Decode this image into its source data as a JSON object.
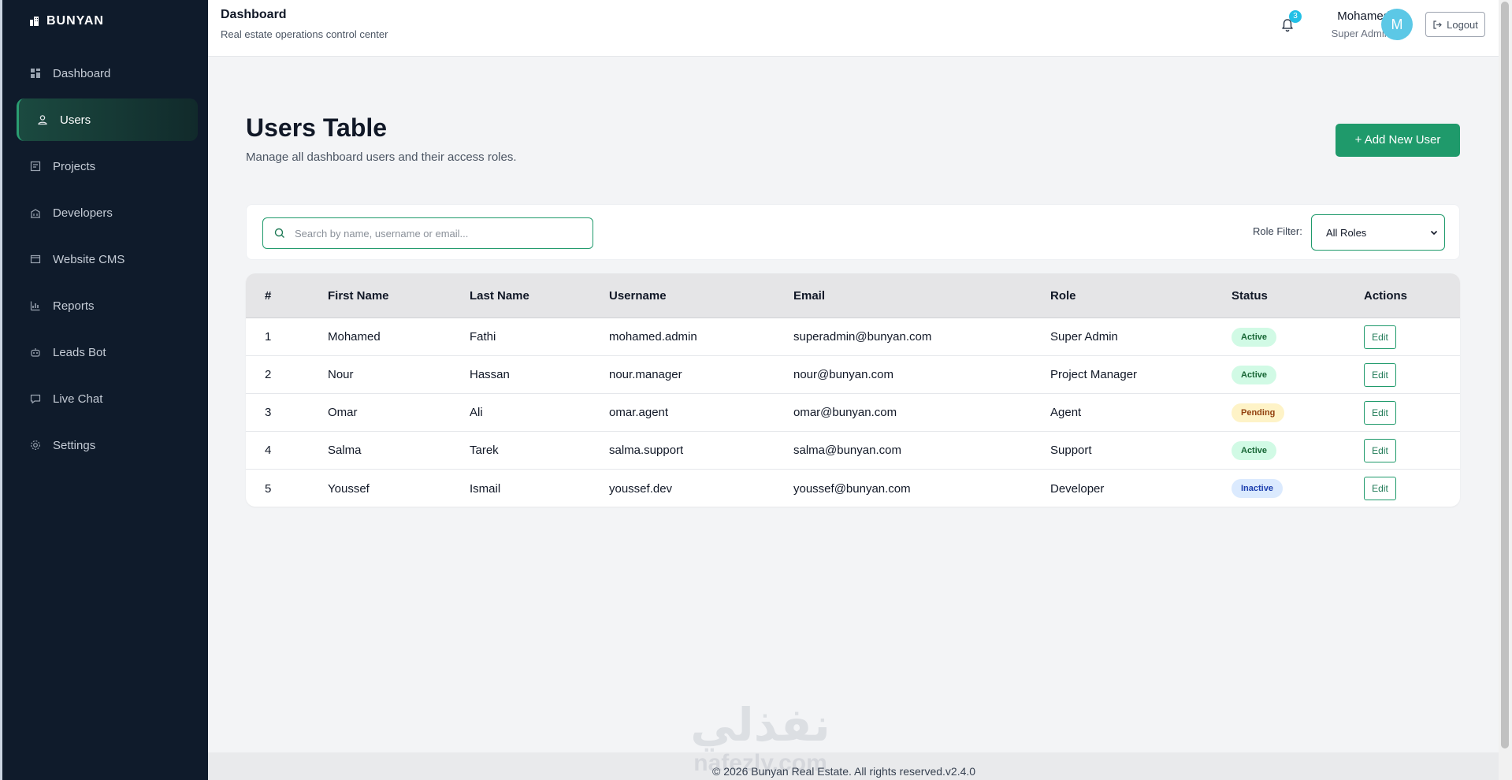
{
  "brand": {
    "name": "BUNYAN"
  },
  "sidebar": {
    "items": [
      {
        "label": "Dashboard",
        "icon": "grid-icon",
        "active": false
      },
      {
        "label": "Users",
        "icon": "users-icon",
        "active": true
      },
      {
        "label": "Projects",
        "icon": "projects-icon",
        "active": false
      },
      {
        "label": "Developers",
        "icon": "building-icon",
        "active": false
      },
      {
        "label": "Website CMS",
        "icon": "cms-icon",
        "active": false
      },
      {
        "label": "Reports",
        "icon": "chart-icon",
        "active": false
      },
      {
        "label": "Leads Bot",
        "icon": "bot-icon",
        "active": false
      },
      {
        "label": "Live Chat",
        "icon": "chat-icon",
        "active": false
      },
      {
        "label": "Settings",
        "icon": "gear-icon",
        "active": false
      }
    ]
  },
  "header": {
    "title": "Dashboard",
    "subtitle": "Real estate operations control center",
    "notification_count": "3",
    "user_name": "Mohamed",
    "user_role": "Super Admin",
    "avatar_initial": "M",
    "logout_label": "Logout"
  },
  "main": {
    "title": "Users Table",
    "subtitle": "Manage all dashboard users and their access roles.",
    "add_button": "+ Add New User",
    "search_placeholder": "Search by name, username or email...",
    "role_filter_label": "Role Filter:",
    "role_filter_value": "All Roles"
  },
  "table": {
    "columns": [
      "#",
      "First Name",
      "Last Name",
      "Username",
      "Email",
      "Role",
      "Status",
      "Actions"
    ],
    "rows": [
      {
        "id": "1",
        "first": "Mohamed",
        "last": "Fathi",
        "username": "mohamed.admin",
        "email": "superadmin@bunyan.com",
        "role": "Super Admin",
        "status": "Active",
        "action": "Edit"
      },
      {
        "id": "2",
        "first": "Nour",
        "last": "Hassan",
        "username": "nour.manager",
        "email": "nour@bunyan.com",
        "role": "Project Manager",
        "status": "Active",
        "action": "Edit"
      },
      {
        "id": "3",
        "first": "Omar",
        "last": "Ali",
        "username": "omar.agent",
        "email": "omar@bunyan.com",
        "role": "Agent",
        "status": "Pending",
        "action": "Edit"
      },
      {
        "id": "4",
        "first": "Salma",
        "last": "Tarek",
        "username": "salma.support",
        "email": "salma@bunyan.com",
        "role": "Support",
        "status": "Active",
        "action": "Edit"
      },
      {
        "id": "5",
        "first": "Youssef",
        "last": "Ismail",
        "username": "youssef.dev",
        "email": "youssef@bunyan.com",
        "role": "Developer",
        "status": "Inactive",
        "action": "Edit"
      }
    ]
  },
  "footer": {
    "text": "© 2026 Bunyan Real Estate. All rights reserved.v2.4.0"
  },
  "watermark": {
    "arabic": "نفذلي",
    "latin": "nafezly.com"
  },
  "colors": {
    "sidebar_bg": "#0f1b2b",
    "accent": "#1f9a6b",
    "avatar": "#5cc8e6",
    "badge": "#22c0e6"
  }
}
